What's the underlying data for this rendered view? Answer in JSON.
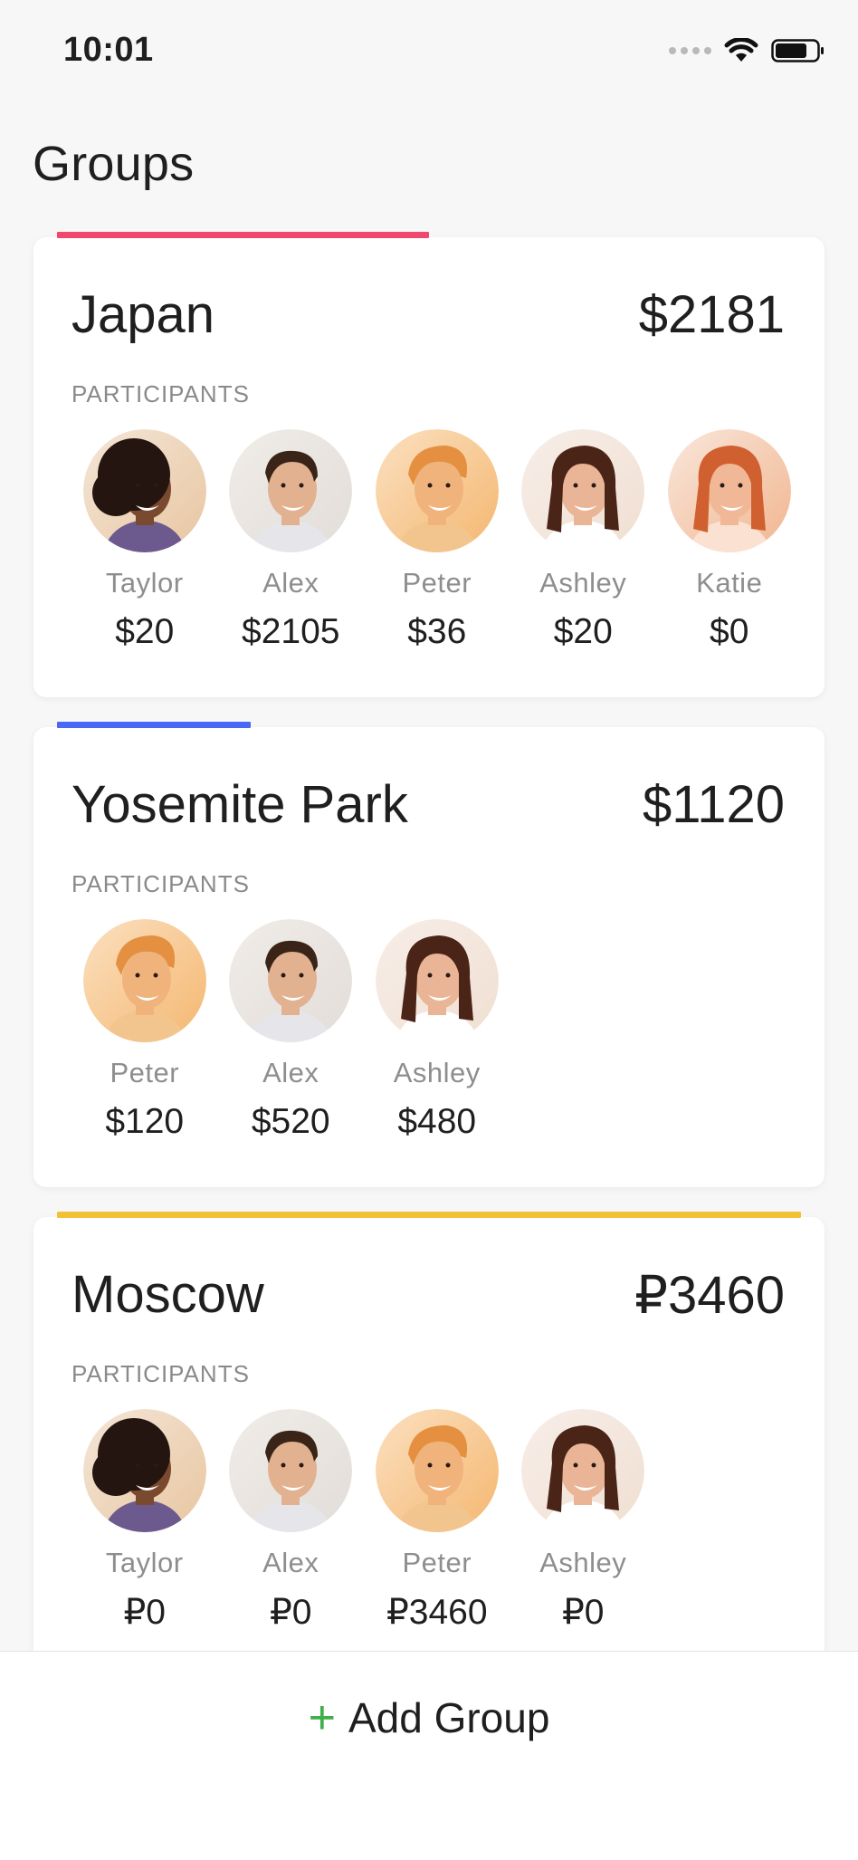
{
  "status_bar": {
    "time": "10:01"
  },
  "header": {
    "title": "Groups"
  },
  "participants_label": "PARTICIPANTS",
  "groups": [
    {
      "name": "Japan",
      "total": "$2181",
      "accent_color": "#f0476e",
      "accent_fraction": 0.5,
      "participants": [
        {
          "name": "Taylor",
          "amount": "$20",
          "avatar": "taylor"
        },
        {
          "name": "Alex",
          "amount": "$2105",
          "avatar": "alex"
        },
        {
          "name": "Peter",
          "amount": "$36",
          "avatar": "peter"
        },
        {
          "name": "Ashley",
          "amount": "$20",
          "avatar": "ashley"
        },
        {
          "name": "Katie",
          "amount": "$0",
          "avatar": "katie"
        }
      ]
    },
    {
      "name": "Yosemite Park",
      "total": "$1120",
      "accent_color": "#4a68f2",
      "accent_fraction": 0.26,
      "participants": [
        {
          "name": "Peter",
          "amount": "$120",
          "avatar": "peter"
        },
        {
          "name": "Alex",
          "amount": "$520",
          "avatar": "alex"
        },
        {
          "name": "Ashley",
          "amount": "$480",
          "avatar": "ashley"
        }
      ]
    },
    {
      "name": "Moscow",
      "total": "₽3460",
      "accent_color": "#f2c236",
      "accent_fraction": 1.0,
      "participants": [
        {
          "name": "Taylor",
          "amount": "₽0",
          "avatar": "taylor"
        },
        {
          "name": "Alex",
          "amount": "₽0",
          "avatar": "alex"
        },
        {
          "name": "Peter",
          "amount": "₽3460",
          "avatar": "peter"
        },
        {
          "name": "Ashley",
          "amount": "₽0",
          "avatar": "ashley"
        }
      ]
    }
  ],
  "bottom": {
    "add_label": "Add Group",
    "plus_icon": "plus-icon",
    "plus_color": "#3fae4b"
  }
}
